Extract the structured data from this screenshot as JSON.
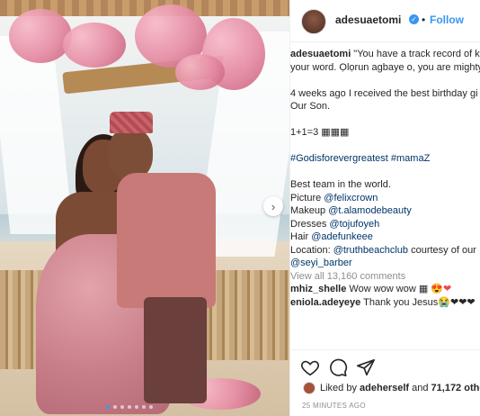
{
  "post": {
    "username": "adesuaetomi",
    "follow_separator": "•",
    "follow_label": "Follow",
    "verified_symbol": "✓"
  },
  "caption": {
    "line1_user": "adesuaetomi",
    "line1_text": " \"You have a track record of k",
    "line2": "your word. Ọlọrun agbaye o, you are mighty",
    "line3": "4 weeks ago I received the best birthday gi",
    "line4": "Our Son.",
    "line5": "1+1=3 ▦▦▦",
    "line6": "#Godisforevergreatest #mamaZ",
    "line7": "Best team in the world.",
    "picture_label": "Picture ",
    "picture_tag": "@felixcrown",
    "makeup_label": "Makeup ",
    "makeup_tag": "@t.alamodebeauty",
    "dresses_label": "Dresses ",
    "dresses_tag": "@tojufoyeh",
    "hair_label": "Hair ",
    "hair_tag": "@adefunkeee",
    "location_label": "Location: ",
    "location_tag": "@truthbeachclub",
    "location_rest": " courtesy of our",
    "last_tag": "@seyi_barber"
  },
  "comments": {
    "view_all": "View all 13,160 comments",
    "items": [
      {
        "user": "mhiz_shelle",
        "text": " Wow wow wow ▦ 😍",
        "heart": "❤"
      },
      {
        "user": "eniola.adeyeye",
        "text": " Thank you Jesus😭❤❤❤"
      }
    ]
  },
  "likes": {
    "prefix": "Liked by ",
    "user": "adeherself",
    "middle": " and ",
    "count": "71,172 othe"
  },
  "timestamp": "25 MINUTES AGO",
  "icons": [
    "heart-icon",
    "comment-icon",
    "share-icon",
    "next-arrow-icon"
  ],
  "carousel": {
    "total": 7,
    "active_index": 0,
    "next_symbol": "›"
  },
  "colors": {
    "link_blue": "#3897f0",
    "tag_navy": "#003569",
    "muted": "#8e8e8e",
    "like_red": "#ed4956"
  }
}
